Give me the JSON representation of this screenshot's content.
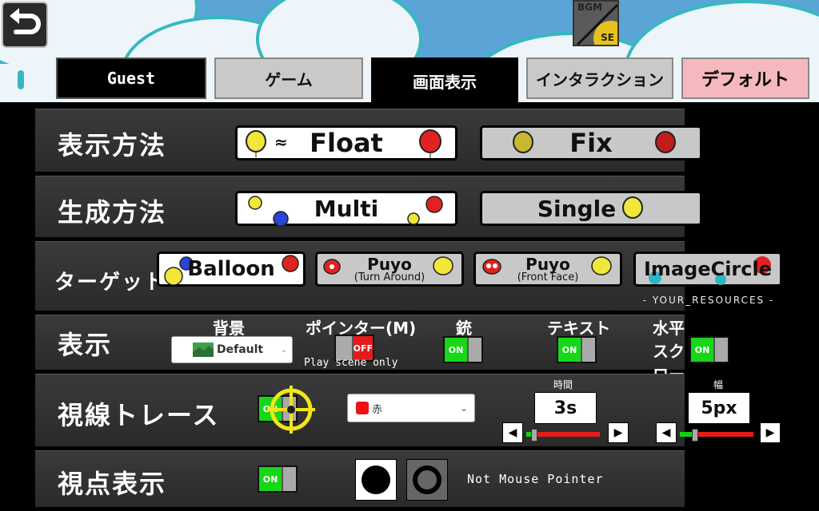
{
  "top": {
    "bgm_label": "BGM",
    "se_label": "SE"
  },
  "tabs": [
    {
      "label": "Guest"
    },
    {
      "label": "ゲーム"
    },
    {
      "label": "画面表示"
    },
    {
      "label": "インタラクション"
    },
    {
      "label": "デフォルト"
    }
  ],
  "rows": {
    "display_method": {
      "label": "表示方法",
      "options": [
        "Float",
        "Fix"
      ],
      "selected": "Float"
    },
    "generate_method": {
      "label": "生成方法",
      "options": [
        "Multi",
        "Single"
      ],
      "selected": "Multi"
    },
    "target": {
      "label": "ターゲット",
      "options": [
        {
          "main": "Balloon",
          "sub": ""
        },
        {
          "main": "Puyo",
          "sub": "(Turn Around)"
        },
        {
          "main": "Puyo",
          "sub": "(Front Face)"
        },
        {
          "main": "ImageCircle",
          "sub": ""
        }
      ],
      "resources_note": "- YOUR_RESOURCES -",
      "selected": "Balloon"
    },
    "display": {
      "label": "表示",
      "background": {
        "header": "背景",
        "value": "Default"
      },
      "pointer": {
        "header": "ポインター(M)",
        "state": "OFF",
        "note": "Play scene only"
      },
      "gun": {
        "header": "銃",
        "state": "ON"
      },
      "text": {
        "header": "テキスト",
        "state": "ON"
      },
      "hscroll": {
        "header": "水平スクロール",
        "state": "ON"
      }
    },
    "gaze_trace": {
      "label": "視線トレース",
      "toggle": "ON",
      "color_value": "赤",
      "time": {
        "header": "時間",
        "value": "3s",
        "fraction": 0.1
      },
      "width": {
        "header": "幅",
        "value": "5px",
        "fraction": 0.2
      }
    },
    "viewpoint": {
      "label": "視点表示",
      "toggle": "ON",
      "note": "Not Mouse Pointer"
    }
  },
  "colors": {
    "sky": "#5aa5d6",
    "on_green": "#18d618",
    "off_red": "#e41b1b",
    "default_tab_pink": "#f5b8bf"
  }
}
